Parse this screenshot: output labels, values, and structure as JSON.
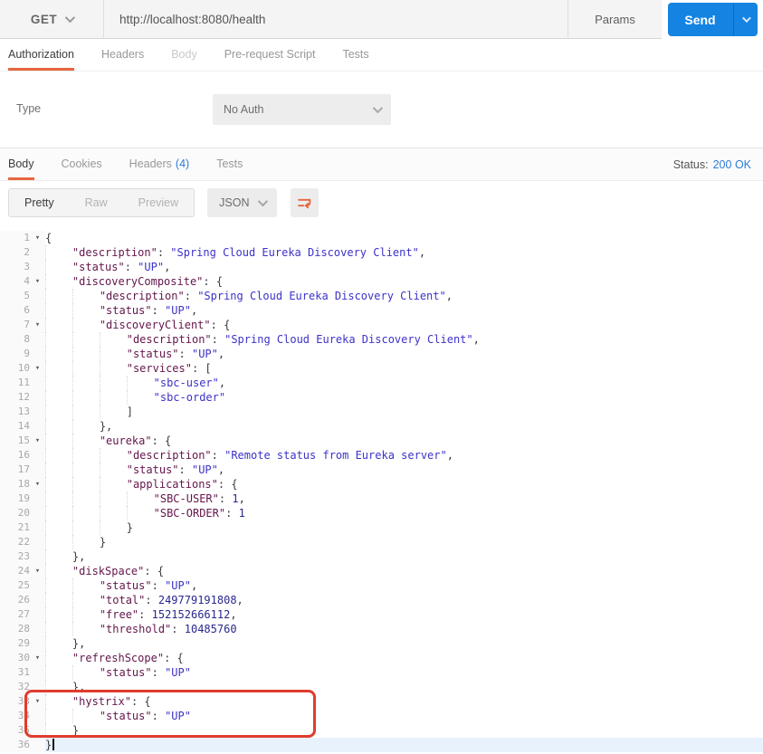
{
  "colors": {
    "accent_orange": "#E8663F",
    "send_blue": "#1583E2",
    "link_blue": "#2D7BD8",
    "annotation_red": "#E03C2F",
    "syntax_key": "#63164B",
    "syntax_string": "#3C32C8",
    "syntax_number": "#28288C",
    "syntax_punct": "#3A3A3A"
  },
  "request_bar": {
    "method": "GET",
    "method_chevron_icon": "chevron-down-icon",
    "url": "http://localhost:8080/health",
    "params_label": "Params",
    "send_label": "Send",
    "send_chevron_icon": "chevron-down-icon"
  },
  "request_tabs": {
    "items": [
      {
        "label": "Authorization",
        "state": "active"
      },
      {
        "label": "Headers",
        "state": "normal"
      },
      {
        "label": "Body",
        "state": "dimmed"
      },
      {
        "label": "Pre-request Script",
        "state": "normal"
      },
      {
        "label": "Tests",
        "state": "normal"
      }
    ]
  },
  "auth_panel": {
    "type_label": "Type",
    "type_value": "No Auth",
    "select_chevron_icon": "chevron-down-icon"
  },
  "response_tabs": {
    "items": [
      {
        "label": "Body",
        "state": "active"
      },
      {
        "label": "Cookies",
        "state": "normal"
      },
      {
        "label": "Headers",
        "count": "(4)",
        "state": "normal"
      },
      {
        "label": "Tests",
        "state": "normal"
      }
    ],
    "status_label": "Status:",
    "status_value": "200 OK"
  },
  "view_toolbar": {
    "modes": [
      {
        "label": "Pretty",
        "state": "active"
      },
      {
        "label": "Raw",
        "state": "normal"
      },
      {
        "label": "Preview",
        "state": "normal"
      }
    ],
    "language": "JSON",
    "language_chevron_icon": "chevron-down-icon",
    "wrap_icon": "wrap-text-icon"
  },
  "annotation": {
    "type": "red-highlight-box",
    "around_lines": "33-35",
    "highlighted_key": "hystrix"
  },
  "code": {
    "active_line": 36,
    "lines": [
      [
        1,
        1,
        0,
        [
          [
            "p",
            "{"
          ]
        ]
      ],
      [
        2,
        0,
        1,
        [
          [
            "k",
            "\"description\""
          ],
          [
            "p",
            ": "
          ],
          [
            "s",
            "\"Spring Cloud Eureka Discovery Client\""
          ],
          [
            "p",
            ","
          ]
        ]
      ],
      [
        3,
        0,
        1,
        [
          [
            "k",
            "\"status\""
          ],
          [
            "p",
            ": "
          ],
          [
            "s",
            "\"UP\""
          ],
          [
            "p",
            ","
          ]
        ]
      ],
      [
        4,
        1,
        1,
        [
          [
            "k",
            "\"discoveryComposite\""
          ],
          [
            "p",
            ": {"
          ]
        ]
      ],
      [
        5,
        0,
        2,
        [
          [
            "k",
            "\"description\""
          ],
          [
            "p",
            ": "
          ],
          [
            "s",
            "\"Spring Cloud Eureka Discovery Client\""
          ],
          [
            "p",
            ","
          ]
        ]
      ],
      [
        6,
        0,
        2,
        [
          [
            "k",
            "\"status\""
          ],
          [
            "p",
            ": "
          ],
          [
            "s",
            "\"UP\""
          ],
          [
            "p",
            ","
          ]
        ]
      ],
      [
        7,
        1,
        2,
        [
          [
            "k",
            "\"discoveryClient\""
          ],
          [
            "p",
            ": {"
          ]
        ]
      ],
      [
        8,
        0,
        3,
        [
          [
            "k",
            "\"description\""
          ],
          [
            "p",
            ": "
          ],
          [
            "s",
            "\"Spring Cloud Eureka Discovery Client\""
          ],
          [
            "p",
            ","
          ]
        ]
      ],
      [
        9,
        0,
        3,
        [
          [
            "k",
            "\"status\""
          ],
          [
            "p",
            ": "
          ],
          [
            "s",
            "\"UP\""
          ],
          [
            "p",
            ","
          ]
        ]
      ],
      [
        10,
        1,
        3,
        [
          [
            "k",
            "\"services\""
          ],
          [
            "p",
            ": ["
          ]
        ]
      ],
      [
        11,
        0,
        4,
        [
          [
            "s",
            "\"sbc-user\""
          ],
          [
            "p",
            ","
          ]
        ]
      ],
      [
        12,
        0,
        4,
        [
          [
            "s",
            "\"sbc-order\""
          ]
        ]
      ],
      [
        13,
        0,
        3,
        [
          [
            "p",
            "]"
          ]
        ]
      ],
      [
        14,
        0,
        2,
        [
          [
            "p",
            "},"
          ]
        ]
      ],
      [
        15,
        1,
        2,
        [
          [
            "k",
            "\"eureka\""
          ],
          [
            "p",
            ": {"
          ]
        ]
      ],
      [
        16,
        0,
        3,
        [
          [
            "k",
            "\"description\""
          ],
          [
            "p",
            ": "
          ],
          [
            "s",
            "\"Remote status from Eureka server\""
          ],
          [
            "p",
            ","
          ]
        ]
      ],
      [
        17,
        0,
        3,
        [
          [
            "k",
            "\"status\""
          ],
          [
            "p",
            ": "
          ],
          [
            "s",
            "\"UP\""
          ],
          [
            "p",
            ","
          ]
        ]
      ],
      [
        18,
        1,
        3,
        [
          [
            "k",
            "\"applications\""
          ],
          [
            "p",
            ": {"
          ]
        ]
      ],
      [
        19,
        0,
        4,
        [
          [
            "k",
            "\"SBC-USER\""
          ],
          [
            "p",
            ": "
          ],
          [
            "n",
            "1"
          ],
          [
            "p",
            ","
          ]
        ]
      ],
      [
        20,
        0,
        4,
        [
          [
            "k",
            "\"SBC-ORDER\""
          ],
          [
            "p",
            ": "
          ],
          [
            "n",
            "1"
          ]
        ]
      ],
      [
        21,
        0,
        3,
        [
          [
            "p",
            "}"
          ]
        ]
      ],
      [
        22,
        0,
        2,
        [
          [
            "p",
            "}"
          ]
        ]
      ],
      [
        23,
        0,
        1,
        [
          [
            "p",
            "},"
          ]
        ]
      ],
      [
        24,
        1,
        1,
        [
          [
            "k",
            "\"diskSpace\""
          ],
          [
            "p",
            ": {"
          ]
        ]
      ],
      [
        25,
        0,
        2,
        [
          [
            "k",
            "\"status\""
          ],
          [
            "p",
            ": "
          ],
          [
            "s",
            "\"UP\""
          ],
          [
            "p",
            ","
          ]
        ]
      ],
      [
        26,
        0,
        2,
        [
          [
            "k",
            "\"total\""
          ],
          [
            "p",
            ": "
          ],
          [
            "n",
            "249779191808"
          ],
          [
            "p",
            ","
          ]
        ]
      ],
      [
        27,
        0,
        2,
        [
          [
            "k",
            "\"free\""
          ],
          [
            "p",
            ": "
          ],
          [
            "n",
            "152152666112"
          ],
          [
            "p",
            ","
          ]
        ]
      ],
      [
        28,
        0,
        2,
        [
          [
            "k",
            "\"threshold\""
          ],
          [
            "p",
            ": "
          ],
          [
            "n",
            "10485760"
          ]
        ]
      ],
      [
        29,
        0,
        1,
        [
          [
            "p",
            "},"
          ]
        ]
      ],
      [
        30,
        1,
        1,
        [
          [
            "k",
            "\"refreshScope\""
          ],
          [
            "p",
            ": {"
          ]
        ]
      ],
      [
        31,
        0,
        2,
        [
          [
            "k",
            "\"status\""
          ],
          [
            "p",
            ": "
          ],
          [
            "s",
            "\"UP\""
          ]
        ]
      ],
      [
        32,
        0,
        1,
        [
          [
            "p",
            "},"
          ]
        ]
      ],
      [
        33,
        1,
        1,
        [
          [
            "k",
            "\"hystrix\""
          ],
          [
            "p",
            ": {"
          ]
        ]
      ],
      [
        34,
        0,
        2,
        [
          [
            "k",
            "\"status\""
          ],
          [
            "p",
            ": "
          ],
          [
            "s",
            "\"UP\""
          ]
        ]
      ],
      [
        35,
        0,
        1,
        [
          [
            "p",
            "}"
          ]
        ]
      ],
      [
        36,
        0,
        0,
        [
          [
            "p",
            "}"
          ]
        ]
      ]
    ]
  }
}
